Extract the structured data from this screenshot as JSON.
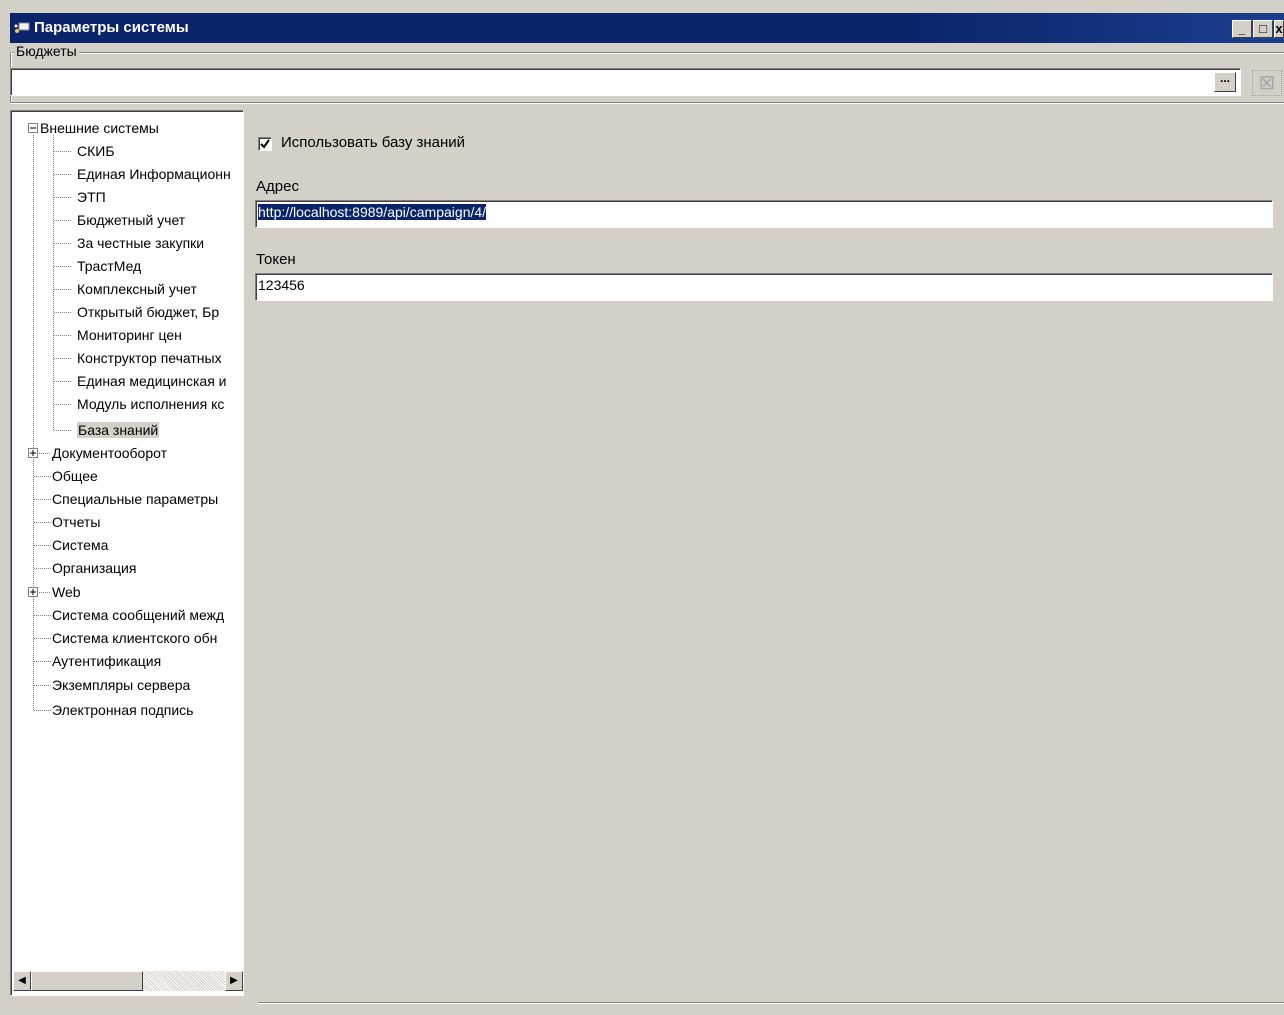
{
  "window": {
    "title": "Параметры системы",
    "buttons": {
      "minimize": "_",
      "maximize": "□",
      "close": "x"
    }
  },
  "budgets": {
    "label": "Бюджеты",
    "value": "",
    "select_button": "...",
    "clear_button": "⊠"
  },
  "tree": {
    "items": [
      {
        "label": "Внешние системы",
        "level": 0,
        "expander": "minus"
      },
      {
        "label": "СКИБ",
        "level": 1
      },
      {
        "label": "Единая Информационн",
        "level": 1
      },
      {
        "label": "ЭТП",
        "level": 1
      },
      {
        "label": "Бюджетный учет",
        "level": 1
      },
      {
        "label": "За честные закупки",
        "level": 1
      },
      {
        "label": "ТрастМед",
        "level": 1
      },
      {
        "label": "Комплексный учет",
        "level": 1
      },
      {
        "label": "Открытый бюджет, Бр",
        "level": 1
      },
      {
        "label": "Мониторинг цен",
        "level": 1
      },
      {
        "label": "Конструктор печатных",
        "level": 1
      },
      {
        "label": "Единая медицинская и",
        "level": 1
      },
      {
        "label": "Модуль исполнения кс",
        "level": 1
      },
      {
        "label": "База знаний",
        "level": 1,
        "selected": true
      },
      {
        "label": "Документооборот",
        "level": 0,
        "expander": "plus"
      },
      {
        "label": "Общее",
        "level": 0
      },
      {
        "label": "Специальные параметры",
        "level": 0
      },
      {
        "label": "Отчеты",
        "level": 0
      },
      {
        "label": "Система",
        "level": 0
      },
      {
        "label": "Организация",
        "level": 0
      },
      {
        "label": "Web",
        "level": 0,
        "expander": "plus"
      },
      {
        "label": "Система сообщений межд",
        "level": 0
      },
      {
        "label": "Система клиентского обн",
        "level": 0
      },
      {
        "label": "Аутентификация",
        "level": 0
      },
      {
        "label": "Экземпляры сервера",
        "level": 0
      },
      {
        "label": "Электронная подпись",
        "level": 0
      }
    ]
  },
  "settings": {
    "use_kb_label": "Использовать базу знаний",
    "use_kb_checked": true,
    "address_label": "Адрес",
    "address_value": "http://localhost:8989/api/campaign/4/",
    "token_label": "Токен",
    "token_value": "123456"
  },
  "colors": {
    "titlebar": "#0a246a",
    "window_bg": "#d4d0c8",
    "selection": "#0a246a"
  }
}
